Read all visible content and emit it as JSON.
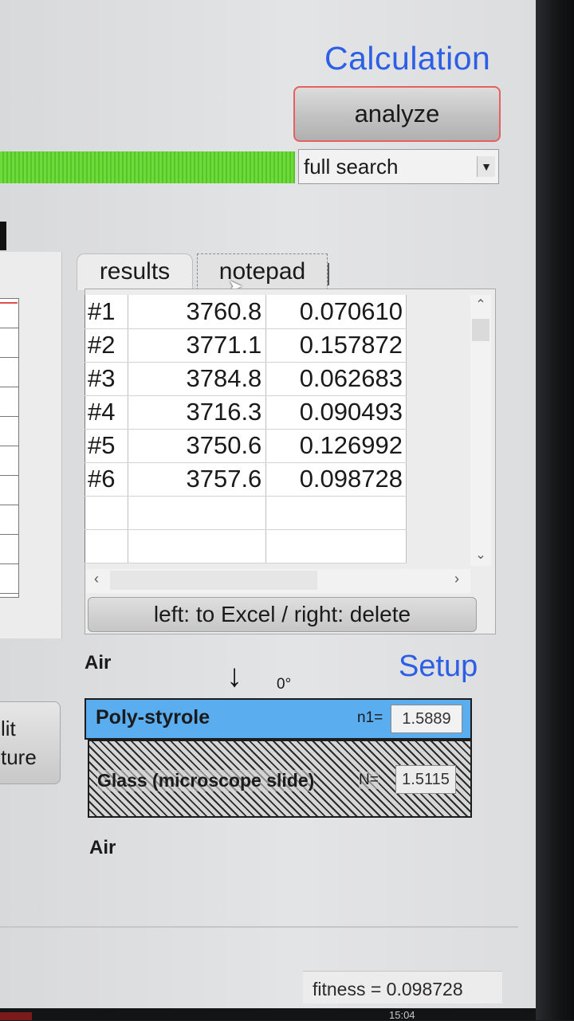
{
  "calculation": {
    "title": "Calculation",
    "analyze_label": "analyze",
    "search_mode": "full search",
    "progress_fraction": 1.0
  },
  "tabs": {
    "results_label": "results",
    "notepad_label": "notepad"
  },
  "results": {
    "rows": [
      {
        "id": "#1",
        "thickness": "3760.8",
        "fitness": "0.070610"
      },
      {
        "id": "#2",
        "thickness": "3771.1",
        "fitness": "0.157872"
      },
      {
        "id": "#3",
        "thickness": "3784.8",
        "fitness": "0.062683"
      },
      {
        "id": "#4",
        "thickness": "3716.3",
        "fitness": "0.090493"
      },
      {
        "id": "#5",
        "thickness": "3750.6",
        "fitness": "0.126992"
      },
      {
        "id": "#6",
        "thickness": "3757.6",
        "fitness": "0.098728"
      },
      {
        "id": "",
        "thickness": "",
        "fitness": ""
      },
      {
        "id": "",
        "thickness": "",
        "fitness": ""
      }
    ],
    "excel_button_label": "left: to Excel / right: delete"
  },
  "setup": {
    "title": "Setup",
    "top_medium": "Air",
    "bottom_medium": "Air",
    "angle": "0°",
    "layers": [
      {
        "name": "Poly-styrole",
        "n_label": "n1=",
        "n_value": "1.5889",
        "color": "#5aaef0"
      },
      {
        "name": "Glass (microscope slide)",
        "n_label": "N=",
        "n_value": "1.5115"
      }
    ]
  },
  "left_panel": {
    "button_line1": "lit",
    "button_line2": "ture"
  },
  "status": {
    "fitness_text": "fitness = 0.098728",
    "clock": "15:04"
  },
  "colors": {
    "accent_blue": "#2c5ee6",
    "progress_green": "#6cdc3a",
    "analyze_border": "#e66060"
  }
}
